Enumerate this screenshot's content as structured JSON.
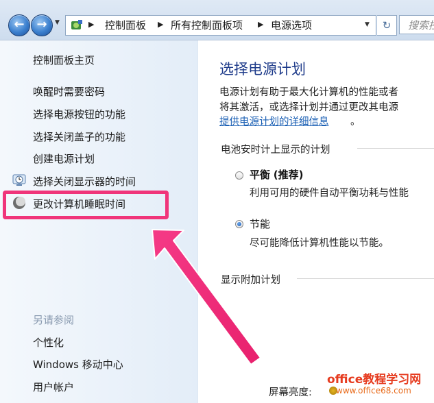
{
  "address_bar": {
    "breadcrumbs": [
      "控制面板",
      "所有控制面板项",
      "电源选项"
    ],
    "search_placeholder": "搜索控"
  },
  "sidebar": {
    "home": "控制面板主页",
    "links": [
      "唤醒时需要密码",
      "选择电源按钮的功能",
      "选择关闭盖子的功能",
      "创建电源计划",
      "选择关闭显示器的时间",
      "更改计算机睡眠时间"
    ],
    "see_also_title": "另请参阅",
    "see_also": [
      "个性化",
      "Windows 移动中心",
      "用户帐户"
    ]
  },
  "main": {
    "title": "选择电源计划",
    "desc_line1": "电源计划有助于最大化计算机的性能或者",
    "desc_line2": "将其激活，或选择计划并通过更改其电源",
    "link": "提供电源计划的详细信息",
    "link_suffix": "。",
    "group_battery": "电池安时计上显示的计划",
    "plans": [
      {
        "name": "平衡",
        "tag": "(推荐)",
        "desc": "利用可用的硬件自动平衡功耗与性能",
        "selected": false
      },
      {
        "name": "节能",
        "tag": "",
        "desc": "尽可能降低计算机性能以节能。",
        "selected": true
      }
    ],
    "group_extra": "显示附加计划",
    "brightness_label": "屏幕亮度:"
  },
  "watermark": {
    "title": "office教程学习网",
    "url": "www.office68.com"
  },
  "colors": {
    "highlight": "#f0357a",
    "title_blue": "#1e3b8a",
    "link_blue": "#1a5fb4"
  }
}
